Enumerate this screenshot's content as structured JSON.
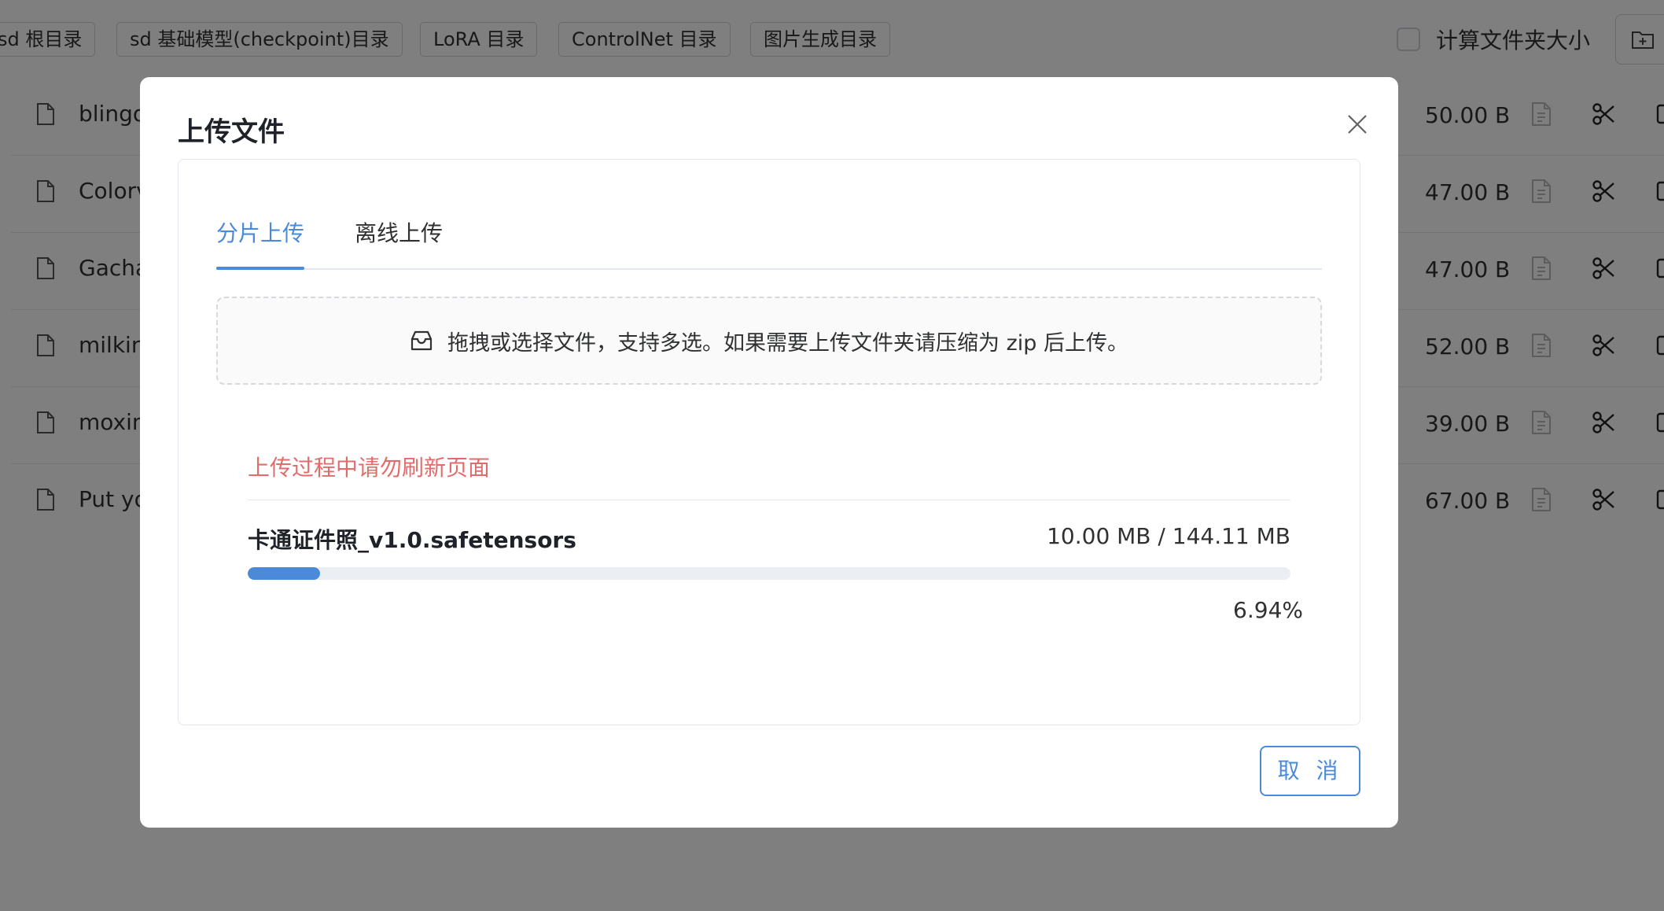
{
  "toolbar": {
    "dir_buttons": [
      {
        "label": "sd 根目录"
      },
      {
        "label": "sd 基础模型(checkpoint)目录"
      },
      {
        "label": "LoRA 目录"
      },
      {
        "label": "ControlNet 目录"
      },
      {
        "label": "图片生成目录"
      }
    ],
    "calc_folder_size_label": "计算文件夹大小"
  },
  "files": [
    {
      "name": "blingd",
      "size": "50.00 B"
    },
    {
      "name": "Colorv",
      "size": "47.00 B"
    },
    {
      "name": "Gacha",
      "size": "47.00 B"
    },
    {
      "name": "milking",
      "size": "52.00 B"
    },
    {
      "name": "moxin",
      "size": "39.00 B"
    },
    {
      "name": "Put yo",
      "size": "67.00 B"
    }
  ],
  "modal": {
    "title": "上传文件",
    "tabs": [
      {
        "label": "分片上传",
        "active": true
      },
      {
        "label": "离线上传",
        "active": false
      }
    ],
    "dropzone_text": "拖拽或选择文件，支持多选。如果需要上传文件夹请压缩为 zip 后上传。",
    "warning": "上传过程中请勿刷新页面",
    "upload": {
      "file_name": "卡通证件照_v1.0.safetensors",
      "size_text": "10.00 MB / 144.11 MB",
      "percent_text": "6.94%",
      "progress_fraction": 0.0694
    },
    "cancel_label": "取 消"
  },
  "colors": {
    "accent": "#4a8ad8",
    "warning": "#e36b6b",
    "overlay": "rgba(0,0,0,0.5)"
  },
  "icons": {
    "file": "file-icon",
    "cut": "scissors-icon",
    "close": "close-icon",
    "inbox": "inbox-icon",
    "new_folder": "folder-add-icon"
  }
}
